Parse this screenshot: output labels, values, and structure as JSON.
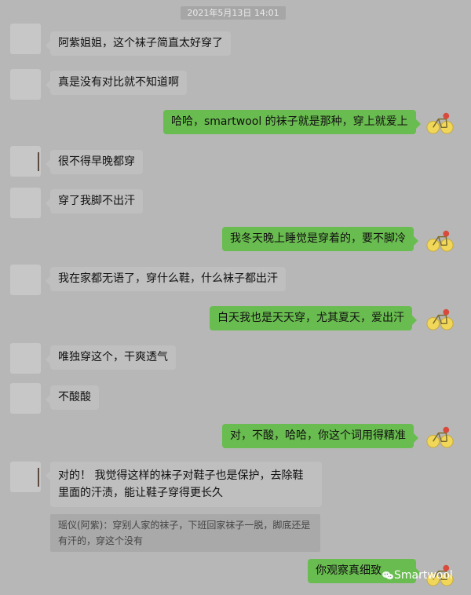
{
  "timestamp": "2021年5月13日 14:01",
  "messages": [
    {
      "side": "left",
      "text": "阿紫姐姐，这个袜子简直太好穿了"
    },
    {
      "side": "left",
      "text": "真是没有对比就不知道啊"
    },
    {
      "side": "right",
      "text": "哈哈，smartwool 的袜子就是那种，穿上就爱上"
    },
    {
      "side": "left",
      "text": "很不得早晚都穿"
    },
    {
      "side": "left",
      "text": "穿了我脚不出汗"
    },
    {
      "side": "right",
      "text": "我冬天晚上睡觉是穿着的，要不脚冷"
    },
    {
      "side": "left",
      "text": "我在家都无语了，穿什么鞋，什么袜子都出汗"
    },
    {
      "side": "right",
      "text": "白天我也是天天穿，尤其夏天，爱出汗"
    },
    {
      "side": "left",
      "text": "唯独穿这个，干爽透气"
    },
    {
      "side": "left",
      "text": "不酸酸"
    },
    {
      "side": "right",
      "text": "对，不酸，哈哈，你这个词用得精准"
    },
    {
      "side": "left",
      "text": "对的！ 我觉得这样的袜子对鞋子也是保护，去除鞋里面的汗渍，能让鞋子穿得更长久"
    },
    {
      "side": "right",
      "text": "你观察真细致"
    }
  ],
  "quote": {
    "text": "瑶仪(阿紫)：穿别人家的袜子，下班回家袜子一脱，脚底还是有汗的，穿这个没有"
  },
  "watermark": "Smartwool",
  "colors": {
    "background": "#b7b7b7",
    "left_bubble": "#bfbfbf",
    "right_bubble": "#69bc4f",
    "timestamp_bg": "#a6a6a6"
  },
  "icons": {
    "right_avatar": "bicycle-icon",
    "watermark_icon": "wechat-icon"
  }
}
